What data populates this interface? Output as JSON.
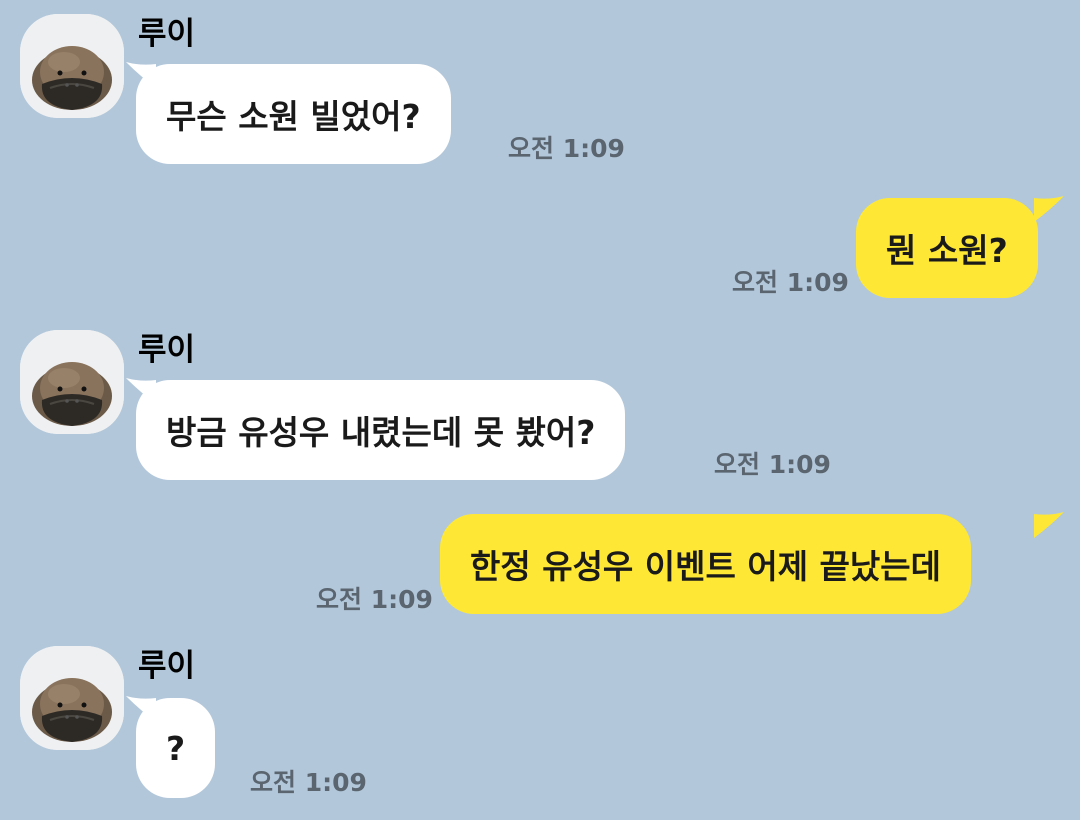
{
  "chat": {
    "colors": {
      "background": "#b2c7da",
      "incoming_bubble": "#ffffff",
      "outgoing_bubble": "#fee835",
      "timestamp": "#5a6570"
    },
    "messages": [
      {
        "direction": "incoming",
        "sender": "루이",
        "avatar_icon": "platypus-avatar-icon",
        "text": "무슨 소원 빌었어?",
        "time": "오전 1:09"
      },
      {
        "direction": "outgoing",
        "text": "뭔 소원?",
        "time": "오전 1:09"
      },
      {
        "direction": "incoming",
        "sender": "루이",
        "avatar_icon": "platypus-avatar-icon",
        "text": "방금 유성우 내렸는데 못 봤어?",
        "time": "오전 1:09"
      },
      {
        "direction": "outgoing",
        "text": "한정 유성우 이벤트 어제 끝났는데",
        "time": "오전 1:09"
      },
      {
        "direction": "incoming",
        "sender": "루이",
        "avatar_icon": "platypus-avatar-icon",
        "text": "?",
        "time": "오전 1:09"
      }
    ]
  }
}
